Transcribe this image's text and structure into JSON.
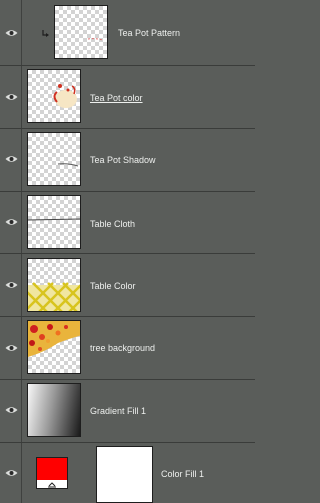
{
  "layers": [
    {
      "name": "Tea Pot Pattern"
    },
    {
      "name": "Tea Pot color"
    },
    {
      "name": "Tea Pot Shadow"
    },
    {
      "name": "Table Cloth"
    },
    {
      "name": "Table Color"
    },
    {
      "name": "tree background"
    },
    {
      "name": "Gradient Fill 1"
    },
    {
      "name": "Color Fill 1"
    }
  ],
  "colors": {
    "panel_bg": "#5a5d5a",
    "fill_color": "#ff0000",
    "table_color": "#e6d23c"
  }
}
